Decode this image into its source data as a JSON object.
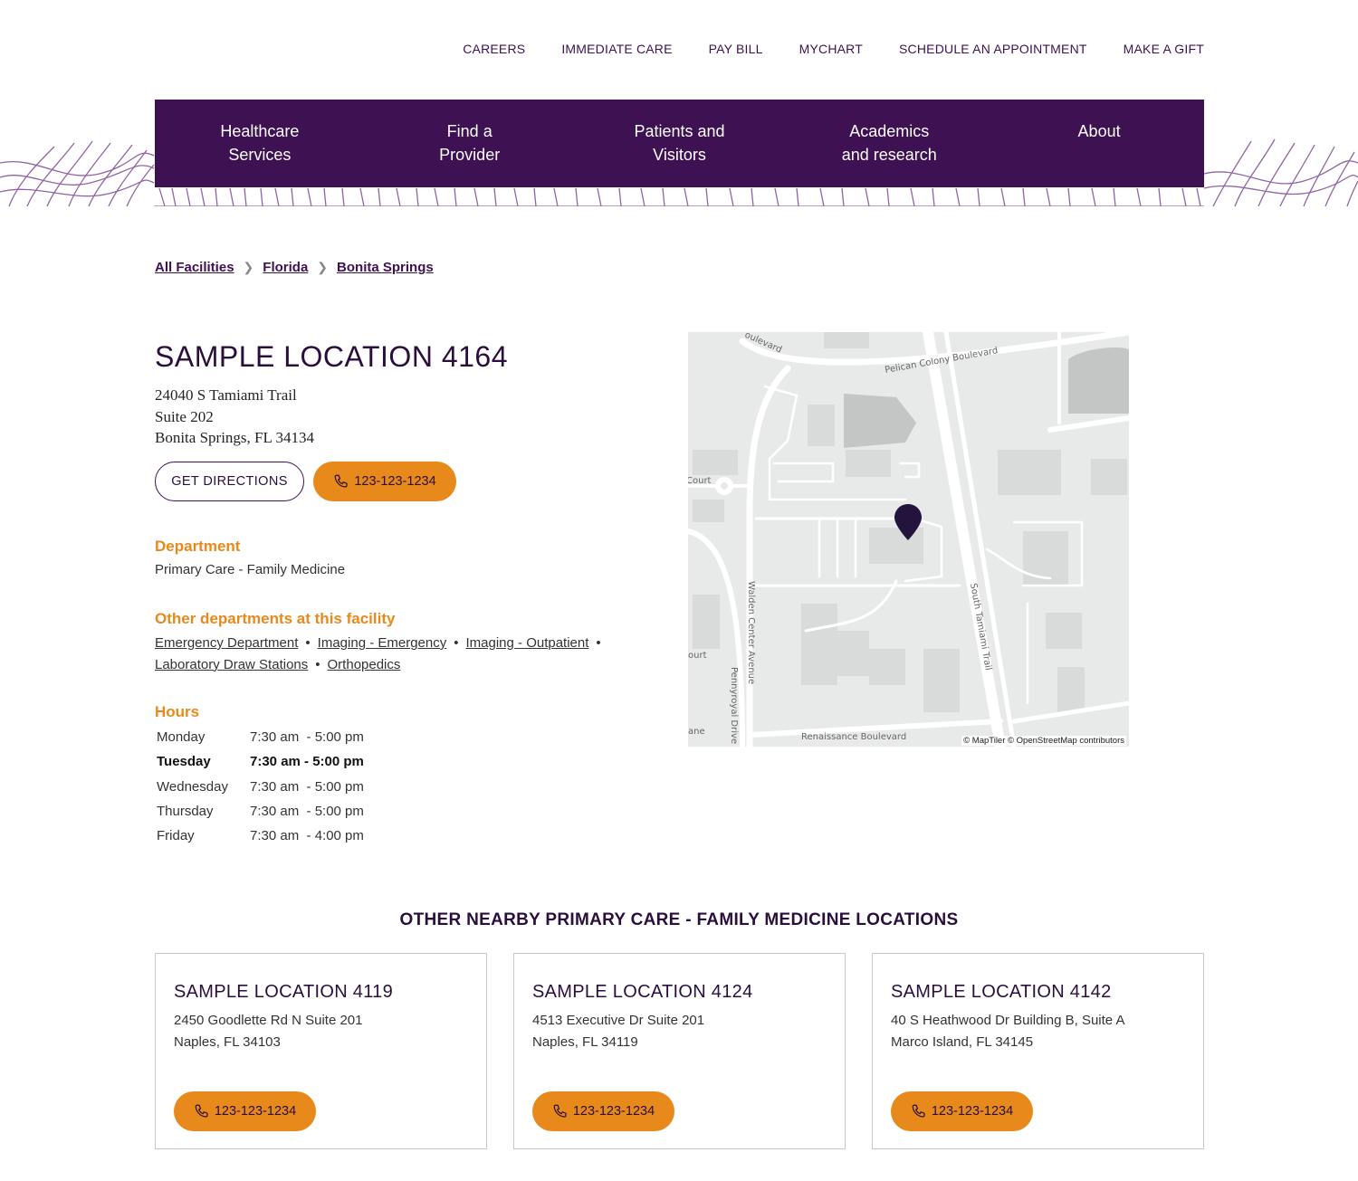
{
  "utility_nav": [
    "CAREERS",
    "IMMEDIATE CARE",
    "PAY BILL",
    "MYCHART",
    "SCHEDULE AN APPOINTMENT",
    "MAKE A GIFT"
  ],
  "main_nav": [
    {
      "line1": "Healthcare",
      "line2": "Services"
    },
    {
      "line1": "Find a",
      "line2": "Provider"
    },
    {
      "line1": "Patients and",
      "line2": "Visitors"
    },
    {
      "line1": "Academics",
      "line2": "and research"
    },
    {
      "line1": "About",
      "line2": ""
    }
  ],
  "breadcrumb": [
    "All Facilities",
    "Florida",
    "Bonita Springs"
  ],
  "location": {
    "title": "SAMPLE LOCATION 4164",
    "address": [
      "24040 S Tamiami Trail",
      "Suite 202",
      "Bonita Springs, FL 34134"
    ],
    "directions_label": "GET DIRECTIONS",
    "phone": "123-123-1234"
  },
  "department": {
    "heading": "Department",
    "value": "Primary Care - Family Medicine"
  },
  "other_departments": {
    "heading": "Other departments at this facility",
    "items": [
      "Emergency Department",
      "Imaging - Emergency",
      "Imaging - Outpatient",
      "Laboratory Draw Stations",
      "Orthopedics"
    ],
    "separator": "•"
  },
  "hours": {
    "heading": "Hours",
    "rows": [
      {
        "day": "Monday",
        "time": "7:30 am  - 5:00 pm"
      },
      {
        "day": "Tuesday",
        "time": "7:30 am - 5:00 pm"
      },
      {
        "day": "Wednesday",
        "time": "7:30 am  - 5:00 pm"
      },
      {
        "day": "Thursday",
        "time": "7:30 am  - 5:00 pm"
      },
      {
        "day": "Friday",
        "time": "7:30 am  - 4:00 pm"
      }
    ],
    "highlighted_day": "Tuesday"
  },
  "map": {
    "labels": {
      "pelican": "Pelican Colony Boulevard",
      "boulevard": "oulevard",
      "walden": "Walden Center Avenue",
      "pennyroyal": "Pennyroyal Drive",
      "tamiami": "South Tamiami Trail",
      "renaissance": "Renaissance Boulevard",
      "court1": "Court",
      "court2": "ourt",
      "lane": "ane"
    },
    "attribution": "© MapTiler © OpenStreetMap contributors"
  },
  "nearby": {
    "heading": "OTHER NEARBY PRIMARY CARE - FAMILY MEDICINE LOCATIONS",
    "cards": [
      {
        "title": "SAMPLE LOCATION 4119",
        "line1": "2450 Goodlette Rd N Suite 201",
        "line2": "Naples, FL 34103",
        "phone": "123-123-1234"
      },
      {
        "title": "SAMPLE LOCATION 4124",
        "line1": "4513 Executive Dr Suite 201",
        "line2": "Naples, FL 34119",
        "phone": "123-123-1234"
      },
      {
        "title": "SAMPLE LOCATION 4142",
        "line1": "40 S Heathwood Dr Building B, Suite A",
        "line2": "Marco Island, FL 34145",
        "phone": "123-123-1234"
      }
    ]
  },
  "colors": {
    "brand_purple": "#3d1152",
    "accent_orange": "#e8891c"
  },
  "icons": [
    "phone-icon",
    "chevron-right-icon",
    "map-pin-icon"
  ]
}
